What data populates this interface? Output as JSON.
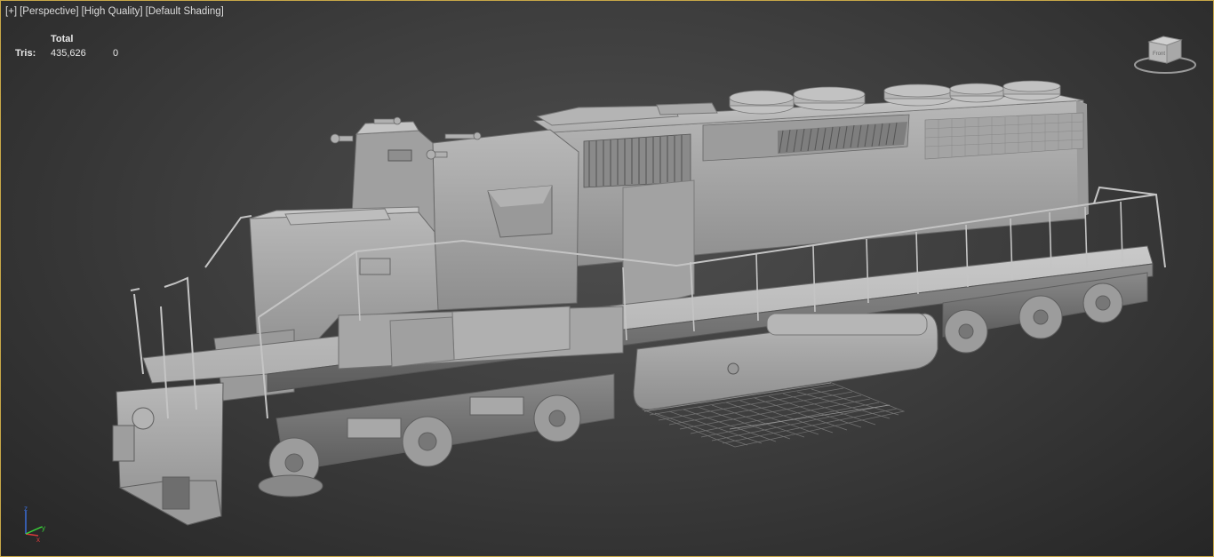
{
  "viewport": {
    "labels": {
      "plus": "[+]",
      "view": "[Perspective]",
      "quality": "[High Quality]",
      "shading": "[Default Shading]"
    },
    "stats": {
      "header": "Total",
      "tris_label": "Tris:",
      "tris_total": "435,626",
      "tris_selected": "0"
    },
    "viewcube": {
      "face_label": "Front"
    },
    "axis_gizmo": {
      "x": "x",
      "y": "y",
      "z": "z"
    },
    "model": "locomotive",
    "colors": {
      "frame_border": "#c8a848",
      "background": "#3e3e3e",
      "model_gray": "#a9a9a9",
      "grid_lines": "#8a8a8a"
    }
  }
}
